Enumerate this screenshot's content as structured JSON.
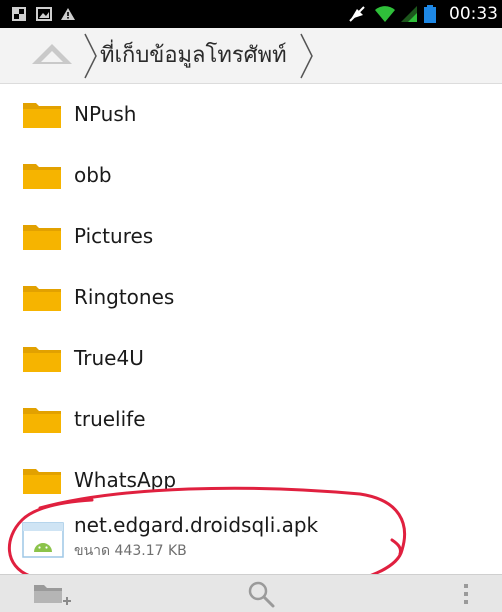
{
  "status_bar": {
    "time": "00:33",
    "icons": [
      "flipboard-icon",
      "image-icon",
      "warning-icon",
      "mute-icon",
      "wifi-icon",
      "signal-icon",
      "battery-icon"
    ],
    "accent": "#1e88e5"
  },
  "path_bar": {
    "home_icon": "home-icon",
    "current_folder": "ที่เก็บข้อมูลโทรศัพท์"
  },
  "files": [
    {
      "name": "NPush",
      "type": "folder"
    },
    {
      "name": "obb",
      "type": "folder"
    },
    {
      "name": "Pictures",
      "type": "folder"
    },
    {
      "name": "Ringtones",
      "type": "folder"
    },
    {
      "name": "True4U",
      "type": "folder"
    },
    {
      "name": "truelife",
      "type": "folder"
    },
    {
      "name": "WhatsApp",
      "type": "folder"
    }
  ],
  "apk_file": {
    "name": "net.edgard.droidsqli.apk",
    "size": "ขนาด 443.17 KB"
  },
  "bottom_bar": {
    "icons": [
      "new-folder-icon",
      "search-icon",
      "overflow-menu-icon"
    ]
  },
  "colors": {
    "folder": "#f6b400",
    "annotation": "#e0203f",
    "status_bar_bg": "#000000"
  }
}
